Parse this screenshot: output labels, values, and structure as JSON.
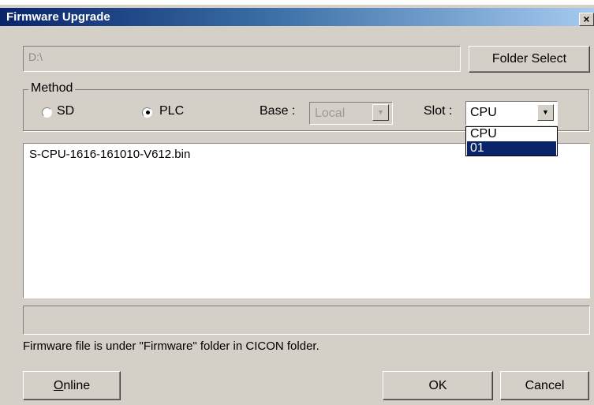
{
  "window": {
    "title": "Firmware Upgrade",
    "close_glyph": "×"
  },
  "path": {
    "value": "D:\\"
  },
  "buttons": {
    "folder_select": "Folder Select",
    "online": "Online",
    "ok": "OK",
    "cancel": "Cancel"
  },
  "method": {
    "group_label": "Method",
    "options": [
      "SD",
      "PLC"
    ],
    "selected": "PLC",
    "base_label": "Base :",
    "base_value": "Local",
    "slot_label": "Slot :",
    "slot_value": "CPU",
    "slot_options": [
      "CPU",
      "01"
    ],
    "slot_highlighted": "01"
  },
  "files": [
    "S-CPU-1616-161010-V612.bin"
  ],
  "status": "",
  "note": "Firmware file is under \"Firmware\" folder in CICON folder.",
  "colors": {
    "face": "#d4d0c8",
    "title_start": "#0a246a",
    "highlight": "#0a246a"
  },
  "icons": {
    "dropdown": "triangle-down-icon",
    "close": "close-icon"
  }
}
